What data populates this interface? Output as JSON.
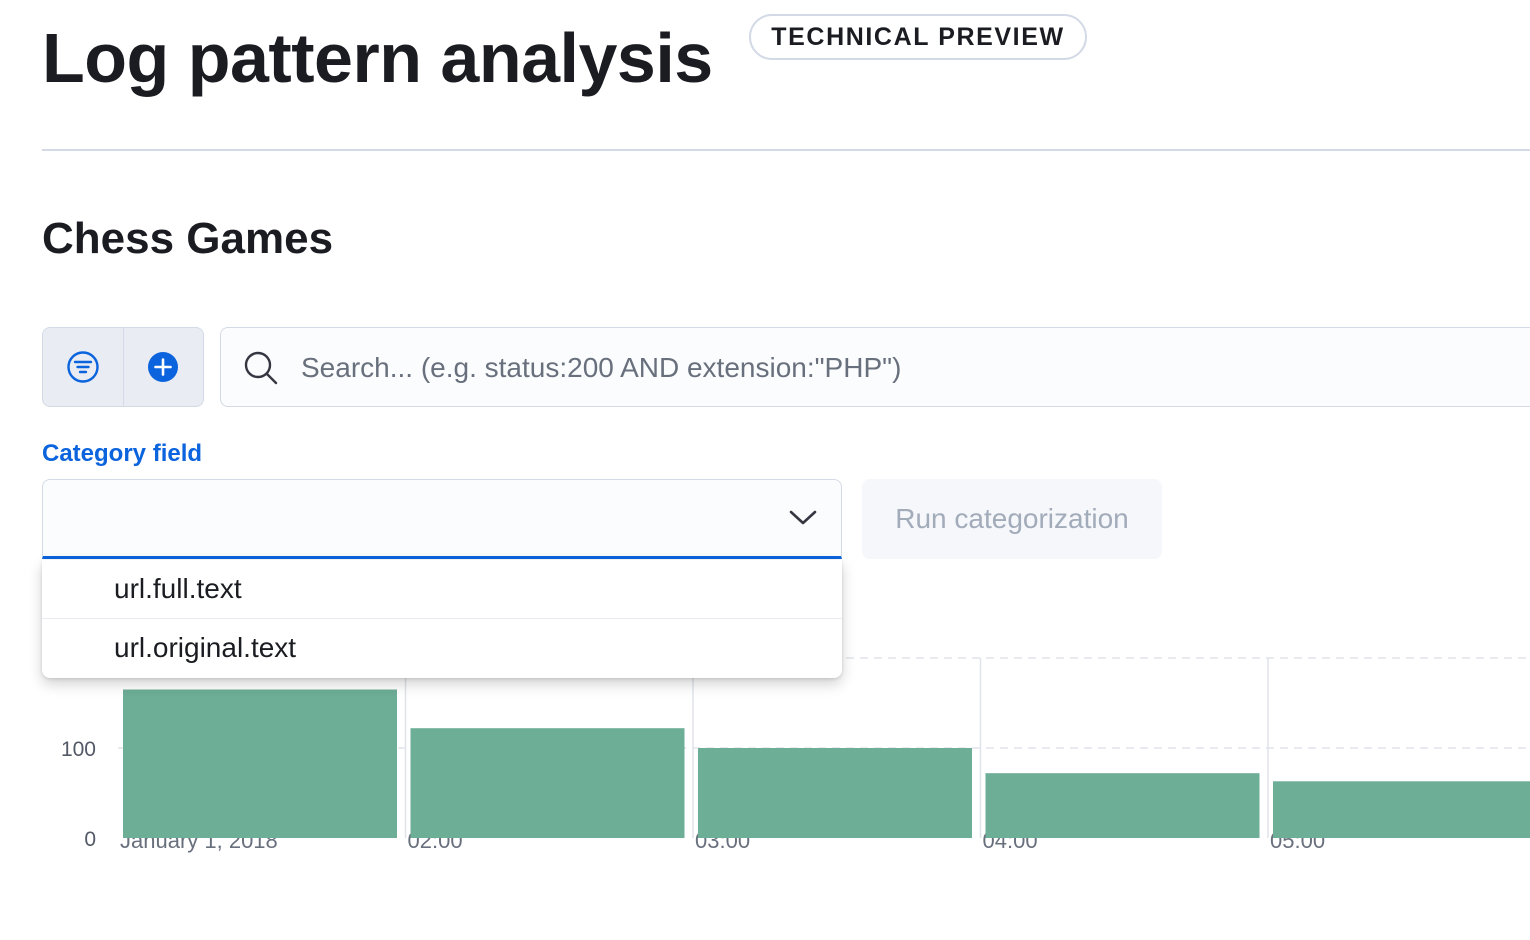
{
  "header": {
    "title": "Log pattern analysis",
    "badge": "TECHNICAL PREVIEW"
  },
  "section": {
    "title": "Chess Games"
  },
  "query_bar": {
    "filter_icon": "filter-icon",
    "add_icon": "plus-circle-icon",
    "search_icon": "search-icon",
    "placeholder": "Search... (e.g. status:200 AND extension:\"PHP\")",
    "value": ""
  },
  "category_field": {
    "label": "Category field",
    "selected": "",
    "chevron_icon": "chevron-down-icon",
    "options": [
      "url.full.text",
      "url.original.text"
    ]
  },
  "run_button": {
    "label": "Run categorization"
  },
  "colors": {
    "accent": "#0b64dd",
    "bar": "#6dae97",
    "title": "#1a1c21"
  },
  "chart_data": {
    "type": "bar",
    "categories": [
      "January 1, 2018",
      "02:00",
      "03:00",
      "04:00",
      "05:00"
    ],
    "values": [
      165,
      122,
      100,
      72,
      63
    ],
    "y_ticks": [
      0,
      100
    ],
    "ylim": [
      0,
      200
    ],
    "grid": true
  }
}
